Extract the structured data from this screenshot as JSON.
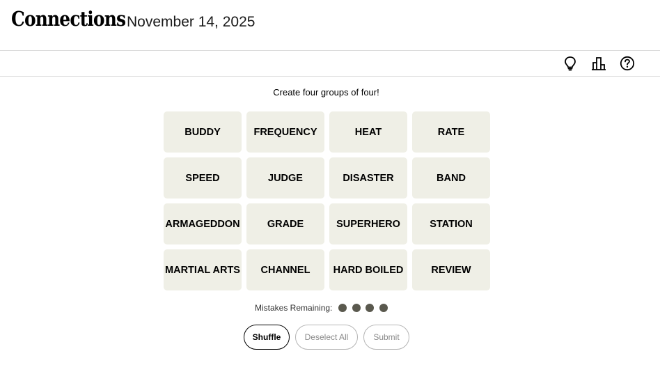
{
  "header": {
    "title": "Connections",
    "date": "November 14, 2025"
  },
  "toolbar": {
    "icons": [
      "lightbulb-icon",
      "leaderboard-icon",
      "help-icon"
    ]
  },
  "game": {
    "prompt": "Create four groups of four!",
    "tiles": [
      "BUDDY",
      "FREQUENCY",
      "HEAT",
      "RATE",
      "SPEED",
      "JUDGE",
      "DISASTER",
      "BAND",
      "ARMAGEDDON",
      "GRADE",
      "SUPERHERO",
      "STATION",
      "MARTIAL ARTS",
      "CHANNEL",
      "HARD BOILED",
      "REVIEW"
    ],
    "mistakes_label": "Mistakes Remaining:",
    "mistakes_remaining": 4,
    "colors": {
      "tile_bg": "#efefe6",
      "dot": "#5a594e"
    }
  },
  "buttons": {
    "shuffle": "Shuffle",
    "deselect": "Deselect All",
    "submit": "Submit"
  }
}
